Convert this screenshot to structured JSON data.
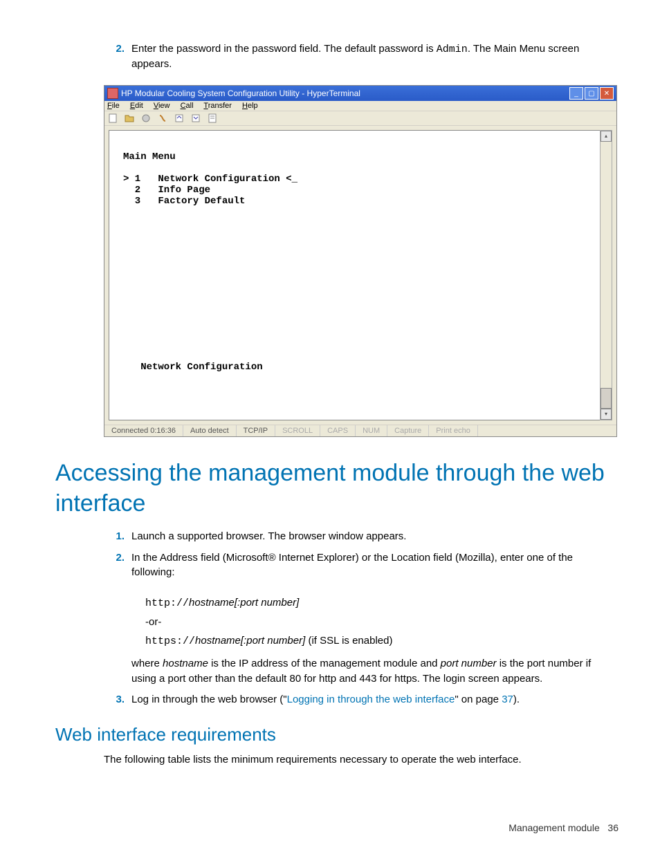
{
  "step2": {
    "num": "2.",
    "text_a": "Enter the password in the password field. The default password is ",
    "code": "Admin",
    "text_b": ".  The Main Menu screen appears."
  },
  "window": {
    "title": "HP Modular Cooling System Configuration Utility - HyperTerminal",
    "menus": {
      "file": "File",
      "edit": "Edit",
      "view": "View",
      "call": "Call",
      "transfer": "Transfer",
      "help": "Help"
    },
    "terminal_text": "\nMain Menu\n\n> 1   Network Configuration <_\n  2   Info Page\n  3   Factory Default\n\n\n\n\n\n\n\n\n\n\n\n\n\n\n   Network Configuration",
    "status": {
      "connected": "Connected 0:16:36",
      "autodetect": "Auto detect",
      "tcpip": "TCP/IP",
      "scroll": "SCROLL",
      "caps": "CAPS",
      "num": "NUM",
      "capture": "Capture",
      "printecho": "Print echo"
    }
  },
  "h1": "Accessing the management module through the web interface",
  "web_steps": {
    "s1": {
      "num": "1.",
      "text": "Launch a supported browser. The browser window appears."
    },
    "s2": {
      "num": "2.",
      "text": "In the Address field (Microsoft® Internet Explorer) or the Location field (Mozilla), enter one of the following:"
    },
    "url_http_code": "http://",
    "url_http_host": "hostname[:port number]",
    "or_text": "-or-",
    "url_https_code": "https://",
    "url_https_host": "hostname[:port number]",
    "url_https_tail": " (if SSL is enabled)",
    "where_a": "where ",
    "where_host": "hostname",
    "where_b": " is the IP address of the management module and ",
    "where_port": "port number",
    "where_c": " is the port number if using a port other than the default 80 for http and 443 for https. The login screen appears.",
    "s3": {
      "num": "3.",
      "text_a": "Log in through the web browser (\"",
      "link": "Logging in through the web interface",
      "text_b": "\" on page ",
      "page": "37",
      "text_c": ")."
    }
  },
  "h2": "Web interface requirements",
  "req_text": "The following table lists the minimum requirements necessary to operate the web interface.",
  "footer": {
    "section": "Management module",
    "page": "36"
  }
}
